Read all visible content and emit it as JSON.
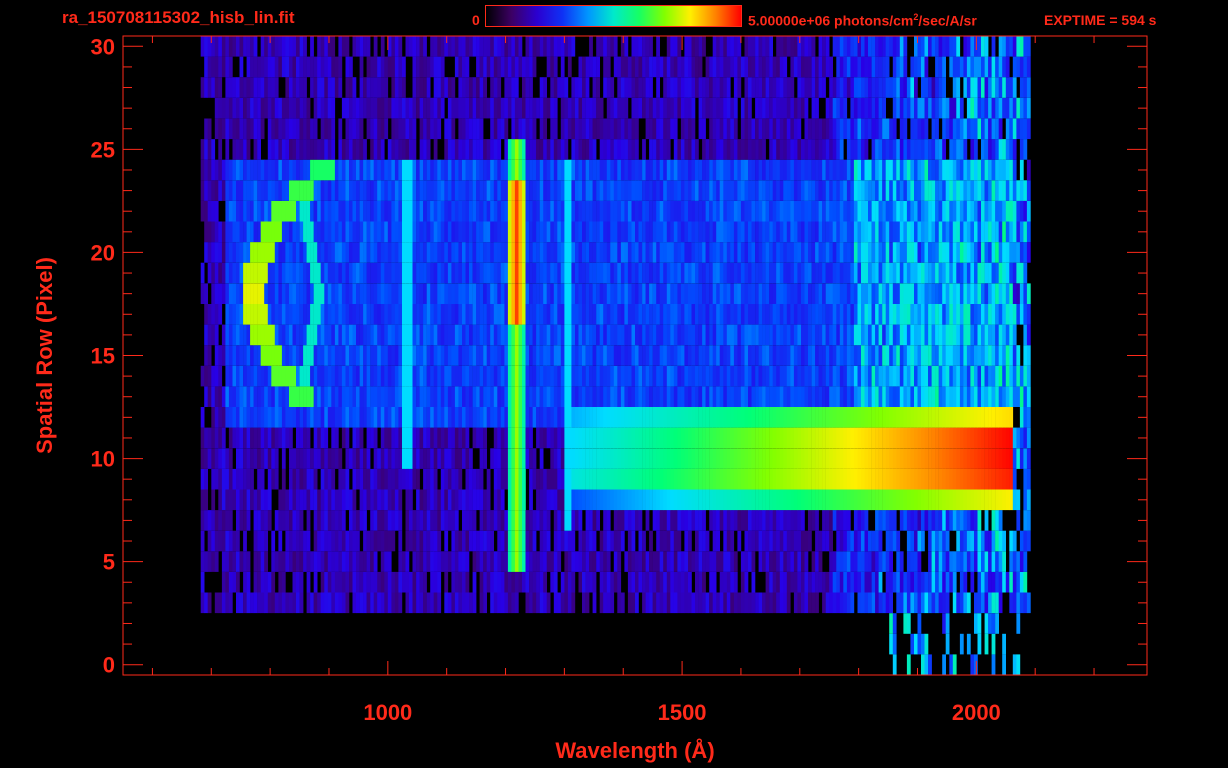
{
  "header": {
    "filename": "ra_150708115302_hisb_lin.fit",
    "colorbar_min": "0",
    "colorbar_max_label": "5.00000e+06 photons/cm",
    "colorbar_max_sup": "2",
    "colorbar_max_tail": "/sec/A/sr",
    "exptime": "EXPTIME = 594 s"
  },
  "colors": {
    "axis": "#ff2a1a",
    "background": "#000000"
  },
  "chart_data": {
    "type": "heatmap",
    "title": "",
    "xlabel": "Wavelength (Å)",
    "ylabel": "Spatial Row (Pixel)",
    "xlim": [
      550,
      2290
    ],
    "ylim": [
      -0.5,
      30.5
    ],
    "x_ticks": [
      1000,
      1500,
      2000
    ],
    "x_tick_labels": [
      "1000",
      "1500",
      "2000"
    ],
    "y_ticks": [
      0,
      5,
      10,
      15,
      20,
      25,
      30
    ],
    "y_tick_labels": [
      "0",
      "5",
      "10",
      "15",
      "20",
      "25",
      "30"
    ],
    "colorbar_range": [
      0,
      5000000
    ],
    "colorbar_units": "photons/cm^2/sec/A/sr",
    "colormap": "rainbow",
    "features": [
      {
        "name": "Ly-alpha line",
        "x_center": 1216,
        "rows": [
          5,
          25
        ],
        "peak_level": 0.95
      },
      {
        "name": "O I line",
        "x_center": 1304,
        "rows": [
          7,
          24
        ],
        "peak_level": 0.35
      },
      {
        "name": "1025 line",
        "x_center": 1030,
        "rows": [
          10,
          24
        ],
        "peak_level": 0.3
      },
      {
        "name": "continuum",
        "x_start": 1310,
        "x_end": 2060,
        "rows": [
          8,
          12
        ],
        "peak_level": 1.0
      },
      {
        "name": "extended arc",
        "x_start": 780,
        "x_end": 900,
        "rows": [
          12,
          24
        ],
        "peak_level": 0.7
      }
    ]
  }
}
